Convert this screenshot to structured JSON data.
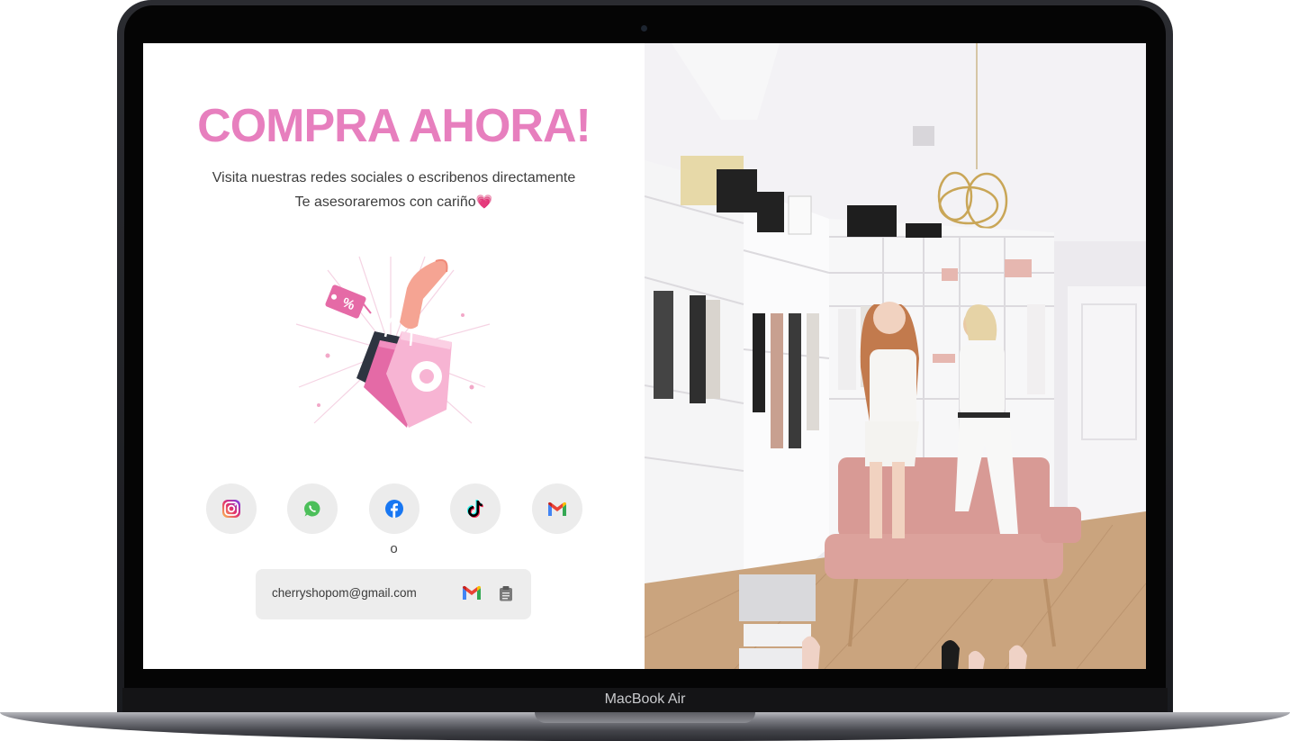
{
  "device": {
    "brand_label": "MacBook Air"
  },
  "hero": {
    "headline": "COMPRA AHORA!",
    "subtitle_line1": "Visita nuestras redes sociales o escribenos directamente",
    "subtitle_line2": "Te asesoraremos con cariño",
    "heart_glyph": "💗"
  },
  "socials": [
    {
      "icon": "instagram-icon",
      "color": "#d6249f"
    },
    {
      "icon": "whatsapp-icon",
      "color": "#4cbf5a"
    },
    {
      "icon": "facebook-icon",
      "color": "#1877f2"
    },
    {
      "icon": "tiktok-icon",
      "color": "#000000"
    },
    {
      "icon": "gmail-icon",
      "color": "#ea4335"
    }
  ],
  "separator_text": "o",
  "contact": {
    "email": "cherryshopom@gmail.com",
    "gmail_icon": "gmail-icon",
    "copy_icon": "clipboard-icon"
  },
  "colors": {
    "accent": "#e77fbe",
    "button_bg": "#ececec"
  }
}
